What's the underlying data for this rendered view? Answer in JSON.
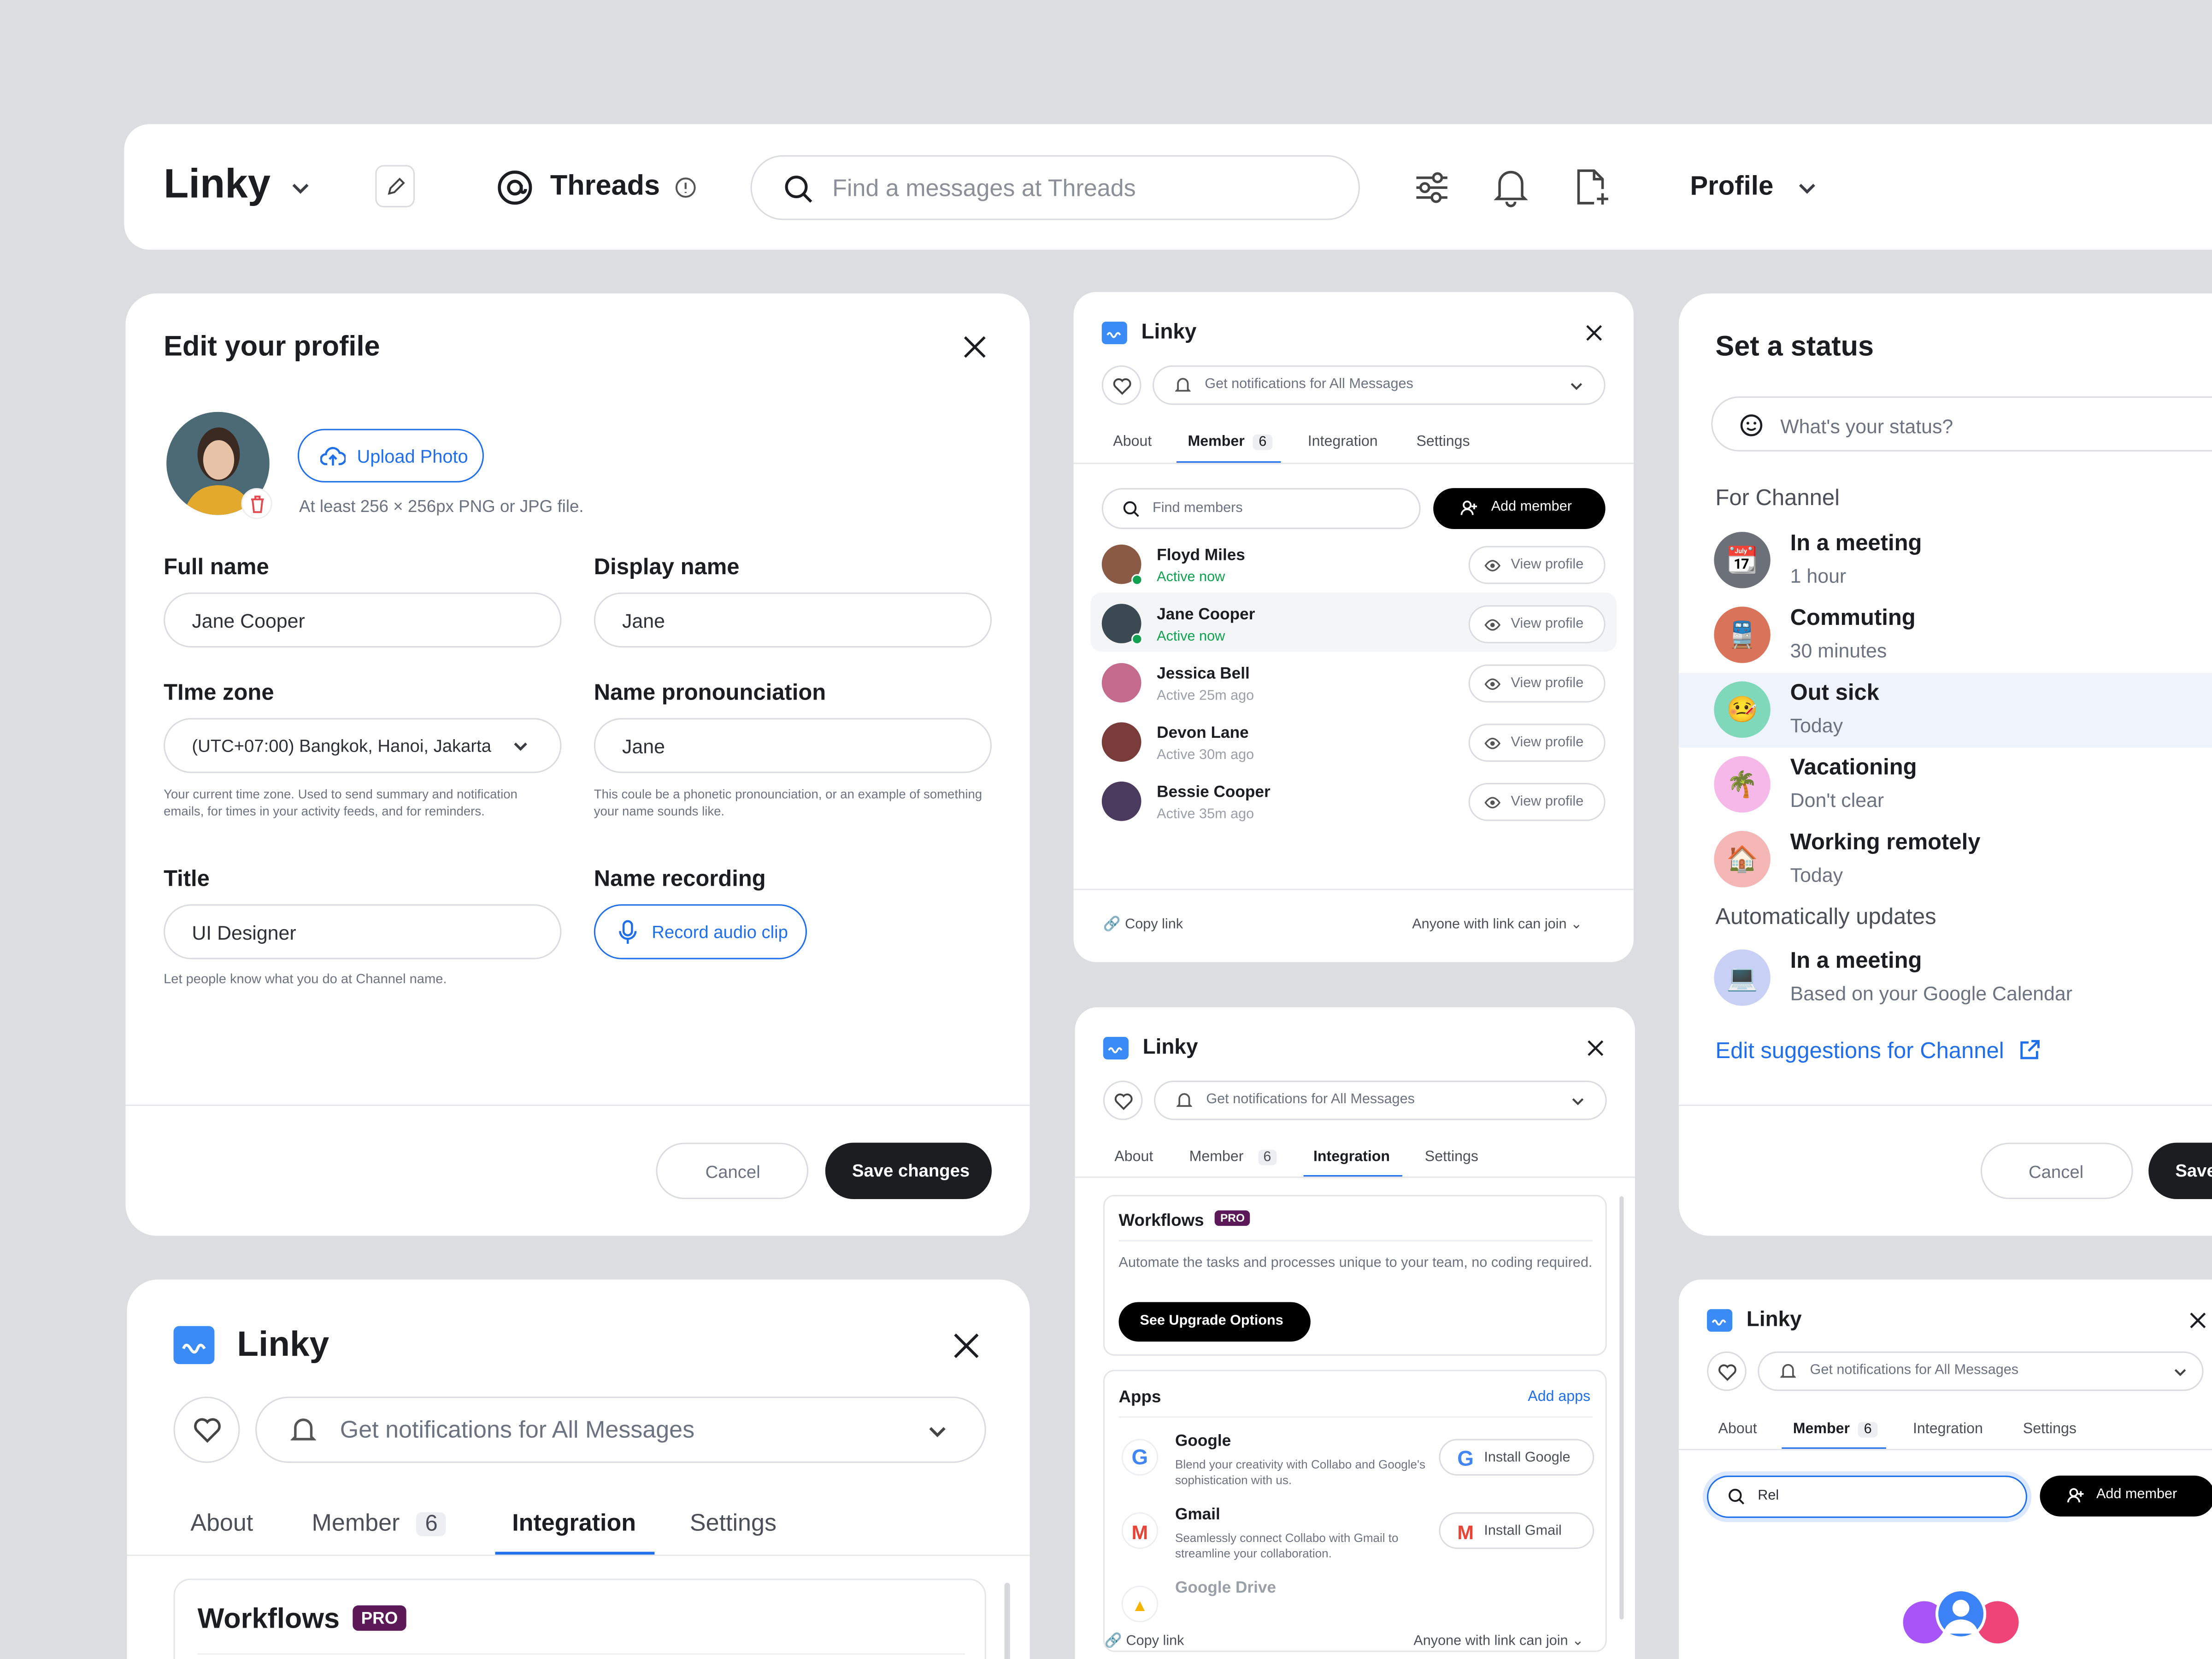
{
  "topbar": {
    "app_name": "Linky",
    "channel": "Threads",
    "search_placeholder": "Find a messages at Threads",
    "profile_label": "Profile"
  },
  "edit_profile": {
    "title": "Edit your profile",
    "upload_label": "Upload Photo",
    "upload_hint": "At least 256 × 256px PNG or JPG file.",
    "full_name_label": "Full name",
    "full_name_value": "Jane Cooper",
    "display_name_label": "Display name",
    "display_name_value": "Jane",
    "timezone_label": "TIme zone",
    "timezone_value": "(UTC+07:00) Bangkok, Hanoi, Jakarta",
    "timezone_hint": "Your current time zone. Used to send summary and notification emails, for times in your activity feeds, and for reminders.",
    "pronunciation_label": "Name pronounciation",
    "pronunciation_value": "Jane",
    "pronunciation_hint": "This coule be a phonetic pronounciation, or an example of something your name sounds like.",
    "title_label": "Title",
    "title_value": "UI Designer",
    "title_hint": "Let people know what you do at Channel name.",
    "recording_label": "Name recording",
    "record_label": "Record audio clip",
    "cancel_label": "Cancel",
    "save_label": "Save changes"
  },
  "member_panel": {
    "app_name": "Linky",
    "notif": "Get notifications for All Messages",
    "tabs": {
      "about": "About",
      "member": "Member",
      "member_count": "6",
      "integration": "Integration",
      "settings": "Settings"
    },
    "find_placeholder": "Find members",
    "add_member": "Add member",
    "members": [
      {
        "name": "Floyd Miles",
        "status": "Active now",
        "active": true
      },
      {
        "name": "Jane Cooper",
        "status": "Active now",
        "active": true
      },
      {
        "name": "Jessica Bell",
        "status": "Active 25m ago",
        "active": false
      },
      {
        "name": "Devon Lane",
        "status": "Active 30m ago",
        "active": false
      },
      {
        "name": "Bessie Cooper",
        "status": "Active 35m ago",
        "active": false
      }
    ],
    "view_profile": "View profile",
    "copy_link": "Copy link",
    "join_setting": "Anyone with link can join"
  },
  "integration_panel": {
    "workflows_title": "Workflows",
    "pro_badge": "PRO",
    "workflows_desc": "Automate the tasks and processes unique to your team, no coding required.",
    "upgrade_label": "See Upgrade Options",
    "apps_title": "Apps",
    "add_apps": "Add apps",
    "apps": [
      {
        "name": "Google",
        "desc": "Blend your creativity with Collabo and Google's sophistication with us.",
        "action": "Install Google"
      },
      {
        "name": "Gmail",
        "desc": "Seamlessly connect Collabo with Gmail to streamline your collaboration.",
        "action": "Install Gmail"
      },
      {
        "name": "Google Drive"
      }
    ]
  },
  "status_panel": {
    "title": "Set a status",
    "placeholder": "What's your status?",
    "for_channel": "For Channel",
    "items": [
      {
        "name": "In a meeting",
        "sub": "1 hour",
        "emoji": "📆",
        "bg": "#6b7079"
      },
      {
        "name": "Commuting",
        "sub": "30 minutes",
        "emoji": "🚆",
        "bg": "#d9735a"
      },
      {
        "name": "Out sick",
        "sub": "Today",
        "emoji": "🤒",
        "bg": "#7fd8b9"
      },
      {
        "name": "Vacationing",
        "sub": "Don't clear",
        "emoji": "🌴",
        "bg": "#f5b8e8"
      },
      {
        "name": "Working remotely",
        "sub": "Today",
        "emoji": "🏠",
        "bg": "#f5b6b6"
      }
    ],
    "auto_updates": "Automatically updates",
    "auto_item": {
      "name": "In a meeting",
      "sub": "Based on your Google Calendar",
      "emoji": "💻",
      "bg": "#c8d0f5"
    },
    "edit_suggestions": "Edit suggestions for Channel",
    "cancel_label": "Cancel",
    "save_label": "Save"
  },
  "search_panel": {
    "search_value": "Rel"
  },
  "colors": {
    "accent": "#1f6feb",
    "active": "#12a150",
    "pro": "#5b1a57",
    "dark": "#1b1d21"
  }
}
